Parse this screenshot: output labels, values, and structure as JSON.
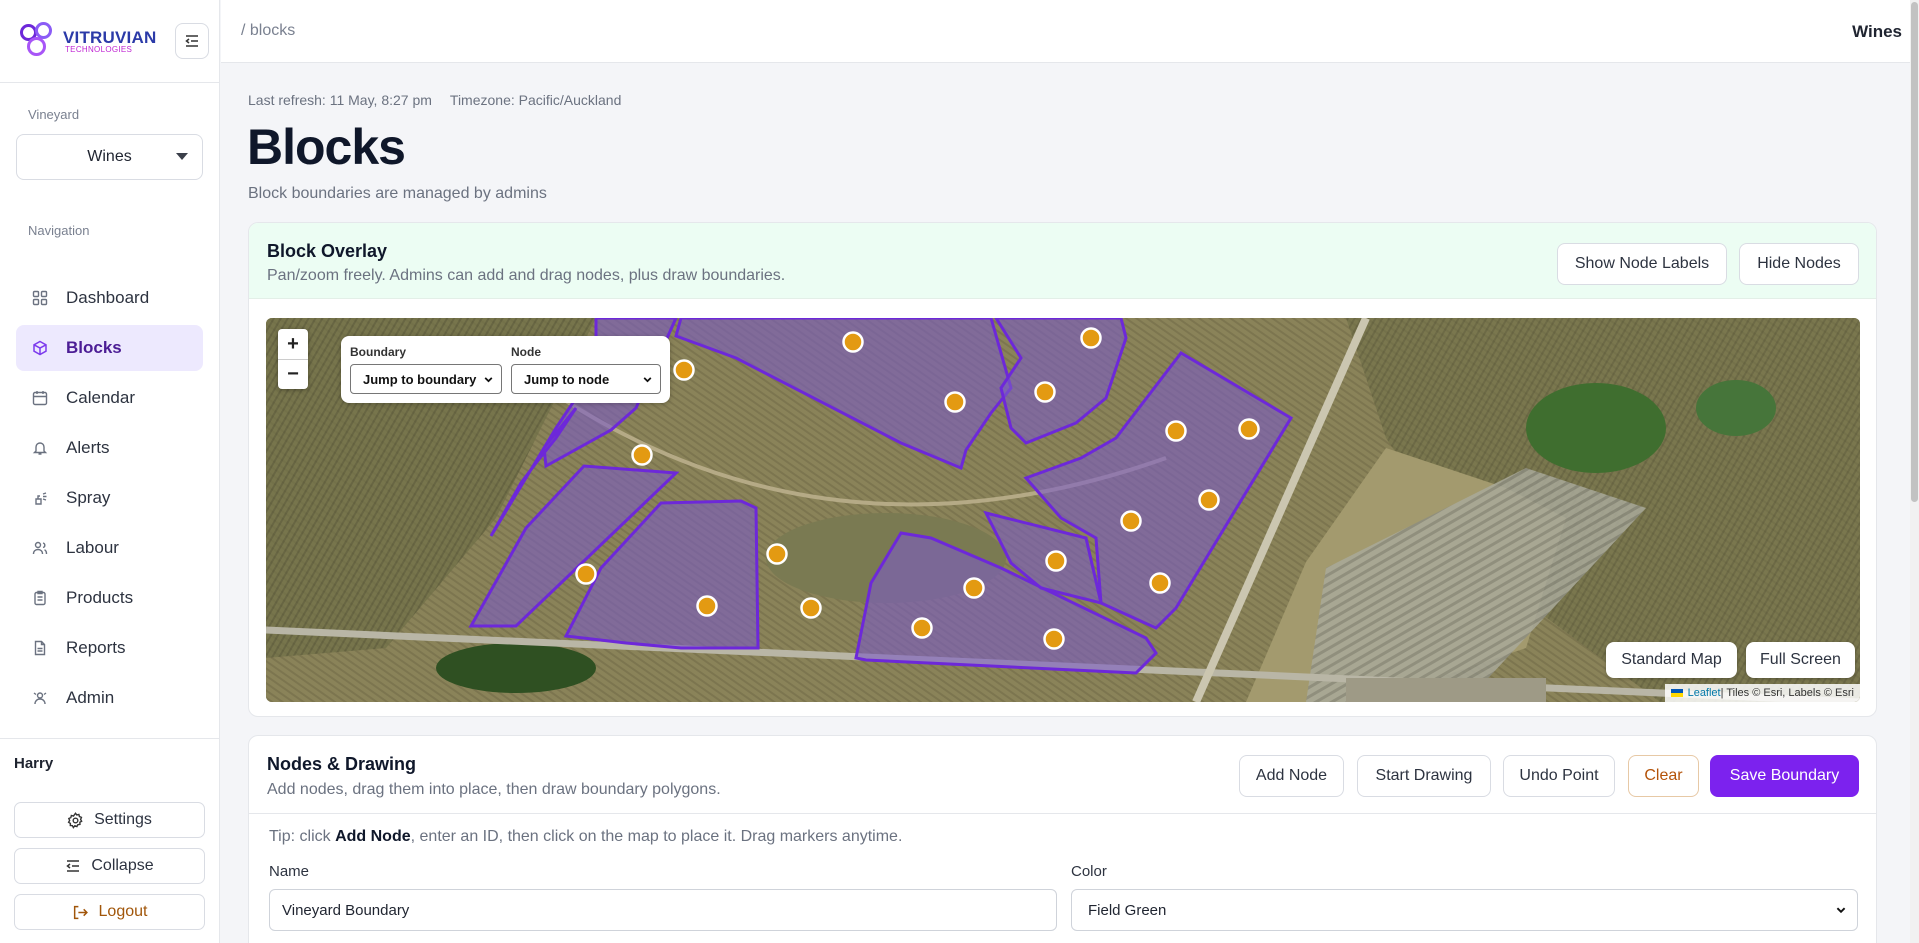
{
  "brand": {
    "name": "VITRUVIAN",
    "tagline": "TECHNOLOGIES"
  },
  "sidebar": {
    "vineyard_label": "Vineyard",
    "vineyard_value": "Wines",
    "nav_label": "Navigation",
    "items": [
      {
        "label": "Dashboard",
        "icon": "dashboard-grid-icon"
      },
      {
        "label": "Blocks",
        "icon": "cube-icon",
        "active": true
      },
      {
        "label": "Calendar",
        "icon": "calendar-icon"
      },
      {
        "label": "Alerts",
        "icon": "bell-icon"
      },
      {
        "label": "Spray",
        "icon": "spray-icon"
      },
      {
        "label": "Labour",
        "icon": "users-icon"
      },
      {
        "label": "Products",
        "icon": "clipboard-icon"
      },
      {
        "label": "Reports",
        "icon": "file-icon"
      },
      {
        "label": "Admin",
        "icon": "admin-icon"
      }
    ],
    "user": "Harry",
    "settings_label": "Settings",
    "collapse_label": "Collapse",
    "logout_label": "Logout"
  },
  "topbar": {
    "breadcrumb": "/ blocks",
    "vineyard": "Wines"
  },
  "header": {
    "last_refresh": "Last refresh: 11 May, 8:27 pm",
    "timezone": "Timezone: Pacific/Auckland",
    "title": "Blocks",
    "subtitle": "Block boundaries are managed by admins"
  },
  "overlay": {
    "title": "Block Overlay",
    "subtitle": "Pan/zoom freely. Admins can add and drag nodes, plus draw boundaries.",
    "show_labels": "Show Node Labels",
    "hide_nodes": "Hide Nodes",
    "zoom_in": "+",
    "zoom_out": "−",
    "boundary_label": "Boundary",
    "boundary_value": "Jump to boundary",
    "node_label": "Node",
    "node_value": "Jump to node",
    "standard_map": "Standard Map",
    "full_screen": "Full Screen",
    "attrib_leaflet": "Leaflet",
    "attrib_rest": " | Tiles © Esri, Labels © Esri",
    "colors": {
      "boundary": "#6d28d9",
      "fill": "#7c5cc4",
      "node": "#e39a12"
    }
  },
  "drawing": {
    "title": "Nodes & Drawing",
    "subtitle": "Add nodes, drag them into place, then draw boundary polygons.",
    "add_node": "Add Node",
    "start_drawing": "Start Drawing",
    "undo_point": "Undo Point",
    "clear": "Clear",
    "save_boundary": "Save Boundary",
    "tip_pre": "Tip: click ",
    "tip_bold": "Add Node",
    "tip_post": ", enter an ID, then click on the map to place it. Drag markers anytime.",
    "name_label": "Name",
    "name_value": "Vineyard Boundary",
    "color_label": "Color",
    "color_value": "Field Green"
  }
}
